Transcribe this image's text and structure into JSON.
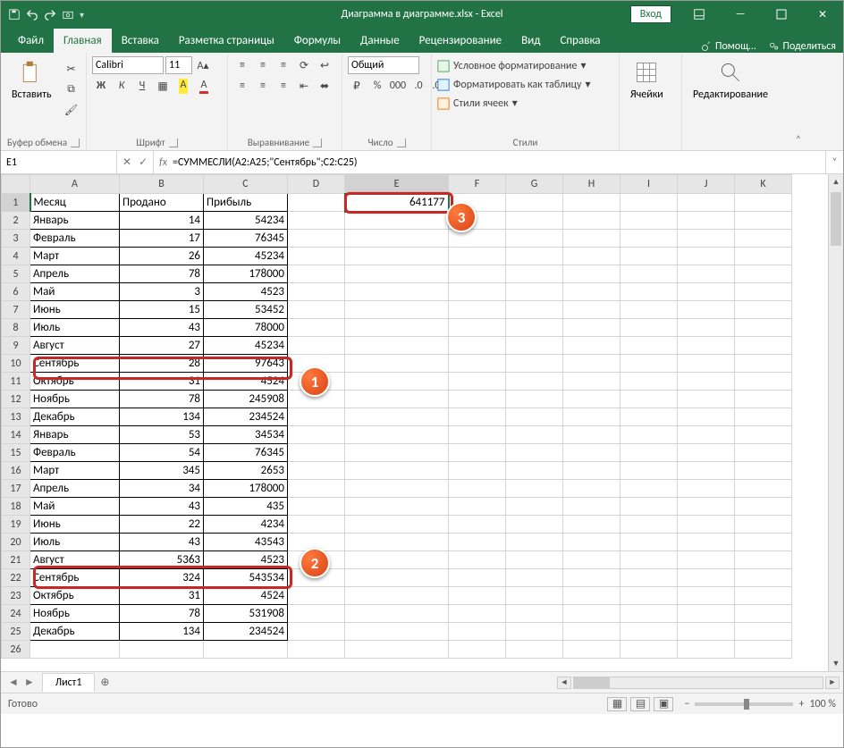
{
  "titlebar": {
    "title": "Диаграмма в диаграмме.xlsx  -  Excel",
    "signin": "Вход"
  },
  "tabs": {
    "file": "Файл",
    "home": "Главная",
    "insert": "Вставка",
    "layout": "Разметка страницы",
    "formulas": "Формулы",
    "data": "Данные",
    "review": "Рецензирование",
    "view": "Вид",
    "help": "Справка",
    "tellme": "Помощ…",
    "share": "Поделиться"
  },
  "ribbon": {
    "clipboard": "Буфер обмена",
    "paste": "Вставить",
    "font": "Шрифт",
    "fontname": "Calibri",
    "fontsize": "11",
    "align": "Выравнивание",
    "number": "Число",
    "numberformat": "Общий",
    "styles": "Стили",
    "cond": "Условное форматирование",
    "table": "Форматировать как таблицу",
    "cellstyles": "Стили ячеек",
    "cells": "Ячейки",
    "editing": "Редактирование"
  },
  "fbar": {
    "name": "E1",
    "formula": "=СУММЕСЛИ(A2:A25;\"Сентябрь\";C2:C25)"
  },
  "columns": [
    "A",
    "B",
    "C",
    "D",
    "E",
    "F",
    "G",
    "H",
    "I",
    "J",
    "K"
  ],
  "headers": {
    "A": "Месяц",
    "B": "Продано",
    "C": "Прибыль"
  },
  "rows": [
    {
      "n": 1,
      "A": "Месяц",
      "B": "Продано",
      "C": "Прибыль",
      "E": "641177"
    },
    {
      "n": 2,
      "A": "Январь",
      "B": 14,
      "C": 54234
    },
    {
      "n": 3,
      "A": "Февраль",
      "B": 17,
      "C": 76345
    },
    {
      "n": 4,
      "A": "Март",
      "B": 26,
      "C": 45234
    },
    {
      "n": 5,
      "A": "Апрель",
      "B": 78,
      "C": 178000
    },
    {
      "n": 6,
      "A": "Май",
      "B": 3,
      "C": 4523
    },
    {
      "n": 7,
      "A": "Июнь",
      "B": 15,
      "C": 53452
    },
    {
      "n": 8,
      "A": "Июль",
      "B": 43,
      "C": 78000
    },
    {
      "n": 9,
      "A": "Август",
      "B": 27,
      "C": 45234
    },
    {
      "n": 10,
      "A": "Сентябрь",
      "B": 28,
      "C": 97643
    },
    {
      "n": 11,
      "A": "Октябрь",
      "B": 31,
      "C": 4524
    },
    {
      "n": 12,
      "A": "Ноябрь",
      "B": 78,
      "C": 245908
    },
    {
      "n": 13,
      "A": "Декабрь",
      "B": 134,
      "C": 234524
    },
    {
      "n": 14,
      "A": "Январь",
      "B": 53,
      "C": 34534
    },
    {
      "n": 15,
      "A": "Февраль",
      "B": 54,
      "C": 76345
    },
    {
      "n": 16,
      "A": "Март",
      "B": 345,
      "C": 2653
    },
    {
      "n": 17,
      "A": "Апрель",
      "B": 34,
      "C": 178000
    },
    {
      "n": 18,
      "A": "Май",
      "B": 43,
      "C": 435
    },
    {
      "n": 19,
      "A": "Июнь",
      "B": 22,
      "C": 4234
    },
    {
      "n": 20,
      "A": "Июль",
      "B": 43,
      "C": 43543
    },
    {
      "n": 21,
      "A": "Август",
      "B": 5363,
      "C": 4523
    },
    {
      "n": 22,
      "A": "Сентябрь",
      "B": 324,
      "C": 543534
    },
    {
      "n": 23,
      "A": "Октябрь",
      "B": 31,
      "C": 4524
    },
    {
      "n": 24,
      "A": "Ноябрь",
      "B": 78,
      "C": 531908
    },
    {
      "n": 25,
      "A": "Декабрь",
      "B": 134,
      "C": 234524
    }
  ],
  "activeCell": "E1",
  "sheet": {
    "name": "Лист1"
  },
  "status": {
    "ready": "Готово",
    "zoom": "100 %"
  },
  "callouts": {
    "one": "1",
    "two": "2",
    "three": "3"
  }
}
